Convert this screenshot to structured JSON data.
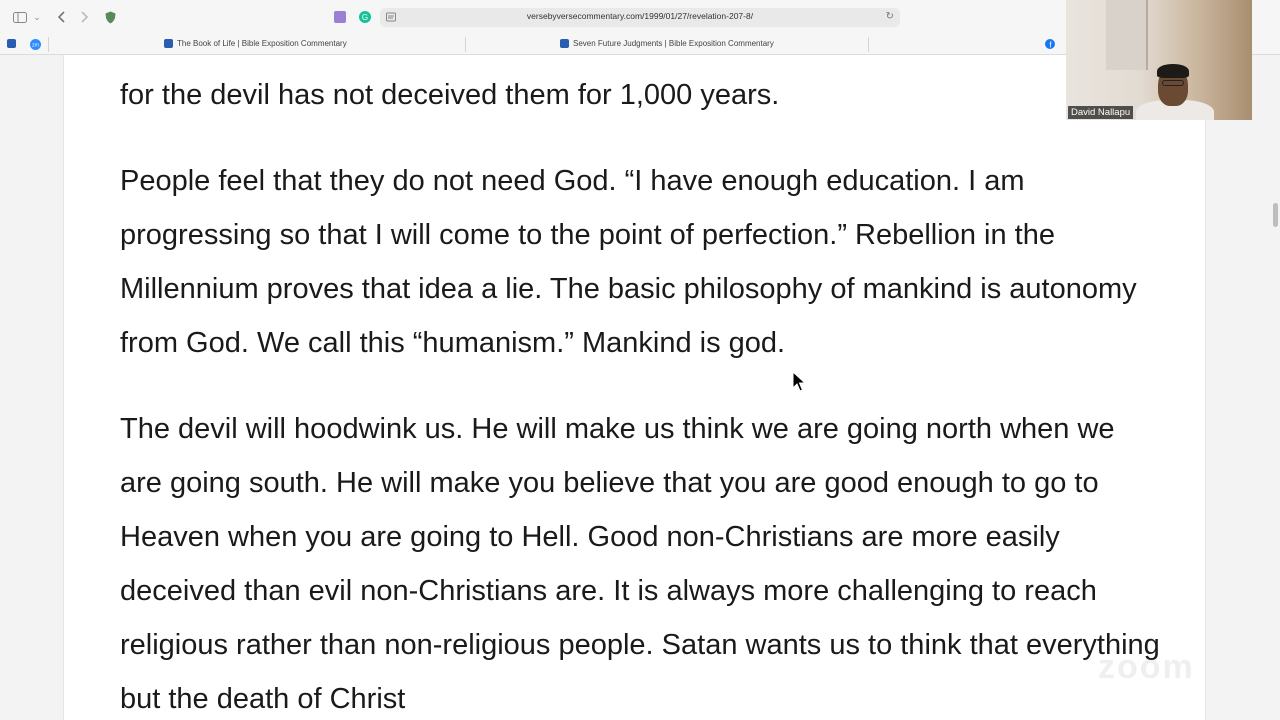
{
  "browser": {
    "url": "versebyversecommentary.com/1999/01/27/revelation-207-8/"
  },
  "bookmarks": [
    {
      "label": "The Book of Life | Bible Exposition Commentary"
    },
    {
      "label": "Seven Future Judgments | Bible Exposition Commentary"
    }
  ],
  "article": {
    "partial_line": "for the devil has not deceived them for 1,000 years.",
    "para1": "People feel that they do not need God. “I have enough education. I am progressing so that I will come to the point of perfection.” Rebellion in the Millennium proves that idea a lie. The basic philosophy of mankind is autonomy from God. We call this “humanism.” Mankind is god.",
    "para2": "The devil will hoodwink us. He will make us think we are going north when we are going south. He will make you believe that you are good enough to go to Heaven when you are going to Hell. Good non-Christians are more easily deceived than evil non-Christians are. It is always more challenging to reach religious rather than non-religious people. Satan wants us to think that everything but the death of Christ"
  },
  "video": {
    "participant_name": "David Nallapu",
    "watermark": "zoom"
  },
  "colors": {
    "text": "#1a1a1a",
    "page_background": "#ffffff",
    "favicon": "#2a5db0"
  }
}
